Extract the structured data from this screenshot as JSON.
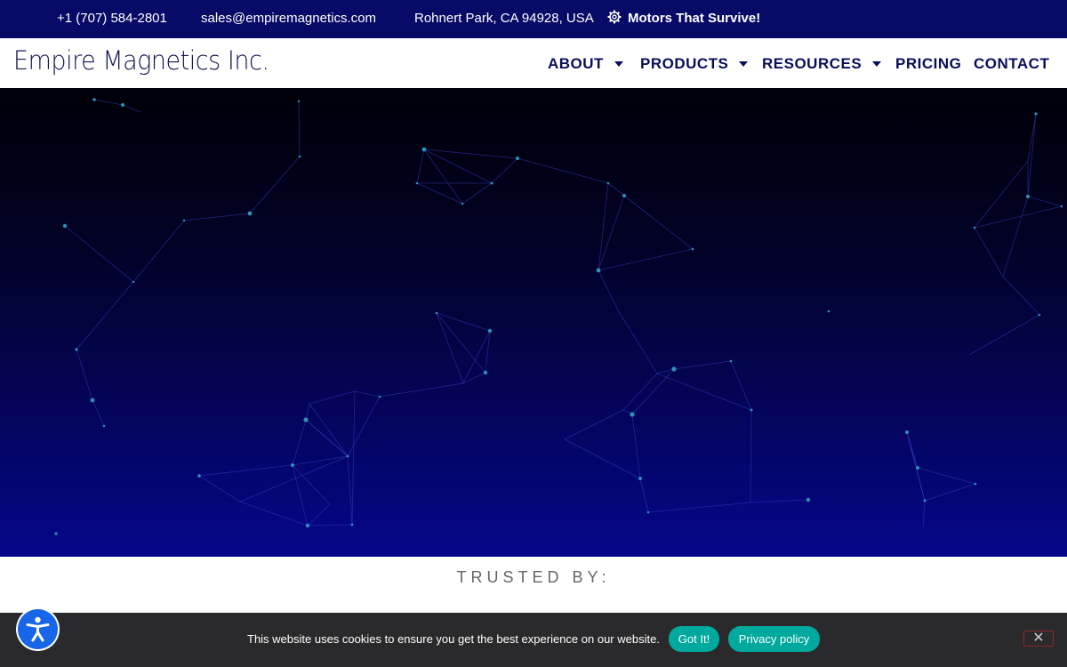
{
  "topbar": {
    "phone": "+1 (707) 584-2801",
    "email": "sales@empiremagnetics.com",
    "location": "Rohnert Park, CA 94928, USA",
    "tagline_icon": "gear-icon",
    "tagline": "Motors That Survive!"
  },
  "header": {
    "logo": "Empire Magnetics Inc.",
    "nav": [
      {
        "label": "ABOUT",
        "dropdown": true
      },
      {
        "label": "PRODUCTS",
        "dropdown": true
      },
      {
        "label": "RESOURCES",
        "dropdown": true
      },
      {
        "label": "PRICING",
        "dropdown": false
      },
      {
        "label": "CONTACT",
        "dropdown": false
      }
    ]
  },
  "hero": {
    "background": "particle network",
    "colors": {
      "top": "#000008",
      "bottom": "#05068a",
      "lines": "#3d3ec8",
      "dots": "#2f8fb5"
    }
  },
  "trusted": {
    "heading": "TRUSTED BY:"
  },
  "cookie": {
    "text": "This website uses cookies to ensure you get the best experience on our website.",
    "ok_label": "Got It!",
    "privacy_label": "Privacy policy",
    "close_icon": "close-icon",
    "accent": "#00a99d"
  },
  "accessibility": {
    "icon": "accessibility-icon",
    "color": "#1766e8"
  }
}
